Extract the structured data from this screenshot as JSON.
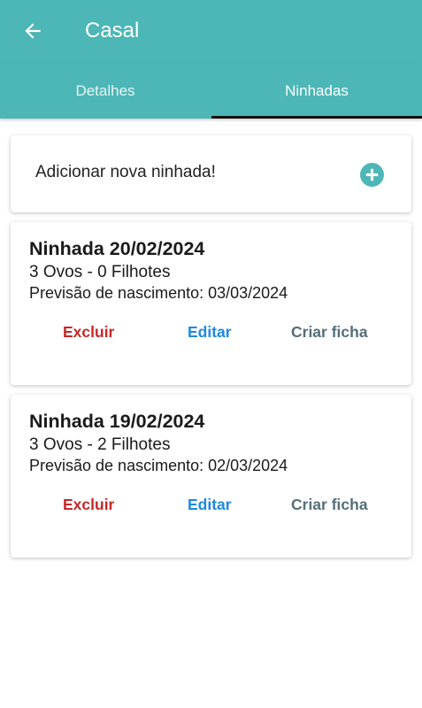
{
  "appbar": {
    "title": "Casal",
    "background": "#4DB6B6",
    "back_icon": "arrow-left-icon"
  },
  "tabs": [
    {
      "label": "Detalhes",
      "selected": false
    },
    {
      "label": "Ninhadas",
      "selected": true
    }
  ],
  "add_card": {
    "label": "Adicionar nova ninhada!",
    "icon": "plus-circle-icon",
    "icon_color": "#4DB6B6"
  },
  "litters": [
    {
      "title": "Ninhada 20/02/2024",
      "counts": "3 Ovos - 0 Filhotes",
      "forecast": "Previsão de nascimento: 03/03/2024",
      "actions": {
        "delete": "Excluir",
        "edit": "Editar",
        "create_sheet": "Criar ficha"
      }
    },
    {
      "title": "Ninhada 19/02/2024",
      "counts": "3 Ovos - 2 Filhotes",
      "forecast": "Previsão de nascimento: 02/03/2024",
      "actions": {
        "delete": "Excluir",
        "edit": "Editar",
        "create_sheet": "Criar ficha"
      }
    }
  ],
  "colors": {
    "delete": "#C62828",
    "edit": "#1E88E5",
    "create_sheet": "#546E7A"
  }
}
